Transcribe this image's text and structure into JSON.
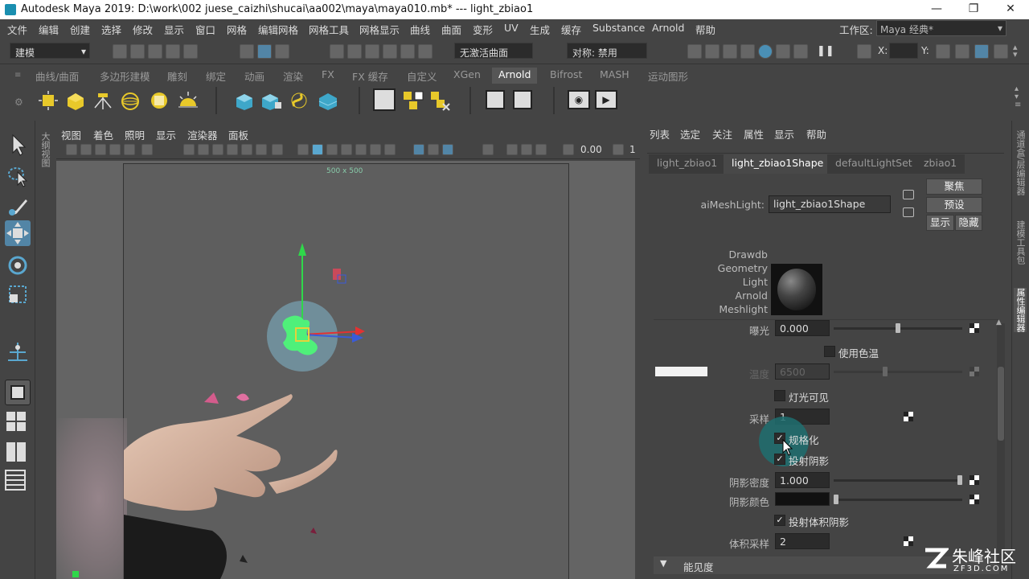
{
  "title": "Autodesk Maya 2019: D:\\work\\002 juese_caizhi\\shucai\\aa002\\maya\\maya010.mb*   ---   light_zbiao1",
  "window_buttons": [
    "—",
    "❐",
    "✕"
  ],
  "menu": [
    "文件",
    "编辑",
    "创建",
    "选择",
    "修改",
    "显示",
    "窗口",
    "网格",
    "编辑网格",
    "网格工具",
    "网格显示",
    "曲线",
    "曲面",
    "变形",
    "UV",
    "生成",
    "缓存",
    "Substance",
    "Arnold",
    "帮助"
  ],
  "workspace": {
    "label": "工作区:",
    "value": "Maya 经典*"
  },
  "status_line": {
    "mode": "建模",
    "live_surface": "无激活曲面",
    "symmetry": "对称: 禁用",
    "x_label": "X:",
    "y_label": "Y:"
  },
  "shelf_tabs": [
    "曲线/曲面",
    "多边形建模",
    "雕刻",
    "绑定",
    "动画",
    "渲染",
    "FX",
    "FX 缓存",
    "自定义",
    "XGen",
    "Arnold",
    "Bifrost",
    "MASH",
    "运动图形"
  ],
  "active_shelf_tab": "Arnold",
  "viewport": {
    "menu": [
      "视图",
      "着色",
      "照明",
      "显示",
      "渲染器",
      "面板"
    ],
    "value": "0.00",
    "value2": "1",
    "resolution": "500 x 500",
    "left_strip_label": "大纲视图"
  },
  "attr_editor": {
    "menu": [
      "列表",
      "选定",
      "关注",
      "属性",
      "显示",
      "帮助"
    ],
    "tabs": [
      "light_zbiao1",
      "light_zbiao1Shape",
      "defaultLightSet",
      "zbiao1"
    ],
    "active_tab": "light_zbiao1Shape",
    "node_type_label": "aiMeshLight:",
    "node_name": "light_zbiao1Shape",
    "buttons": {
      "focus": "聚焦",
      "presets": "预设",
      "show": "显示",
      "hide": "隐藏"
    },
    "swatch_lines": [
      "Drawdb",
      "Geometry",
      "Light",
      "Arnold",
      "Meshlight"
    ],
    "exposure_label": "曝光",
    "exposure": "0.000",
    "use_color_temp": "使用色温",
    "temperature_label": "温度",
    "temperature": "6500",
    "light_visible": "灯光可见",
    "samples_label": "采样",
    "samples": "1",
    "normalize": "规格化",
    "cast_shadows": "投射阴影",
    "shadow_density_label": "阴影密度",
    "shadow_density": "1.000",
    "shadow_color_label": "阴影颜色",
    "cast_volumetric": "投射体积阴影",
    "volume_samples_label": "体积采样",
    "volume_samples": "2",
    "section_visibility": "能见度"
  },
  "right_strip": [
    "通道盒/层编辑器",
    "建模工具包",
    "属性编辑器"
  ],
  "watermark": {
    "name": "朱峰社区",
    "url": "ZF3D.COM"
  },
  "colors": {
    "accent": "#5285a6",
    "bg": "#444444",
    "field": "#2b2b2b",
    "viewport": "#646464"
  }
}
